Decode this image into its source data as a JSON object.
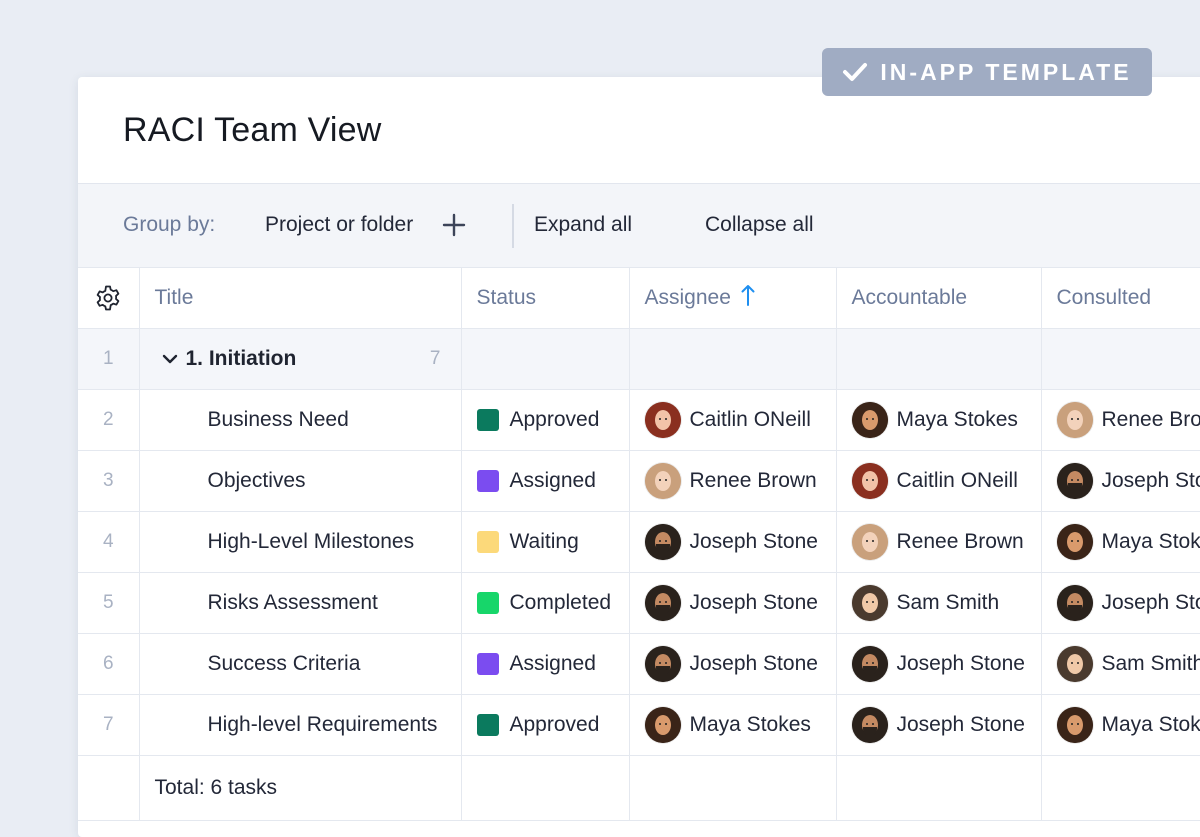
{
  "badge": {
    "label": "IN-APP TEMPLATE",
    "icon": "check-icon"
  },
  "page_title": "RACI Team View",
  "toolbar": {
    "group_by_label": "Group by:",
    "group_by_value": "Project or folder",
    "add_icon": "plus-icon",
    "expand_all": "Expand all",
    "collapse_all": "Collapse all"
  },
  "table": {
    "settings_icon": "gear-icon",
    "headers": {
      "title": "Title",
      "status": "Status",
      "assignee": "Assignee",
      "accountable": "Accountable",
      "consulted": "Consulted"
    },
    "sort_icon": "arrow-up-icon",
    "group": {
      "row_num": "1",
      "label": "1. Initiation",
      "count": "7"
    },
    "rows": [
      {
        "num": "2",
        "title": "Business Need",
        "status": "Approved",
        "assignee": "Caitlin ONeill",
        "accountable": "Maya Stokes",
        "consulted": "Renee Brown"
      },
      {
        "num": "3",
        "title": "Objectives",
        "status": "Assigned",
        "assignee": "Renee Brown",
        "accountable": "Caitlin ONeill",
        "consulted": "Joseph Stone"
      },
      {
        "num": "4",
        "title": "High-Level Milestones",
        "status": "Waiting",
        "assignee": "Joseph Stone",
        "accountable": "Renee Brown",
        "consulted": "Maya Stokes"
      },
      {
        "num": "5",
        "title": "Risks Assessment",
        "status": "Completed",
        "assignee": "Joseph Stone",
        "accountable": "Sam Smith",
        "consulted": "Joseph Stone"
      },
      {
        "num": "6",
        "title": "Success Criteria",
        "status": "Assigned",
        "assignee": "Joseph Stone",
        "accountable": "Joseph Stone",
        "consulted": "Sam Smith"
      },
      {
        "num": "7",
        "title": "High-level Requirements",
        "status": "Approved",
        "assignee": "Maya Stokes",
        "accountable": "Joseph Stone",
        "consulted": "Maya Stokes"
      }
    ],
    "total": "Total: 6 tasks"
  },
  "status_colors": {
    "Approved": "#0b7a5e",
    "Assigned": "#7b4cf0",
    "Waiting": "#fcd97a",
    "Completed": "#17d66a"
  },
  "avatars": {
    "Caitlin ONeill": {
      "hair": "#8a2f1f",
      "skin": "#f2c3a8"
    },
    "Renee Brown": {
      "hair": "#c9a07c",
      "skin": "#f3d2bb"
    },
    "Joseph Stone": {
      "hair": "#2a221c",
      "skin": "#c48a62",
      "beard": "#2a221c"
    },
    "Maya Stokes": {
      "hair": "#3a2418",
      "skin": "#d99a6c"
    },
    "Sam Smith": {
      "hair": "#4a3a2e",
      "skin": "#f0c9a8"
    }
  },
  "accent_color": "#1f8ff0"
}
